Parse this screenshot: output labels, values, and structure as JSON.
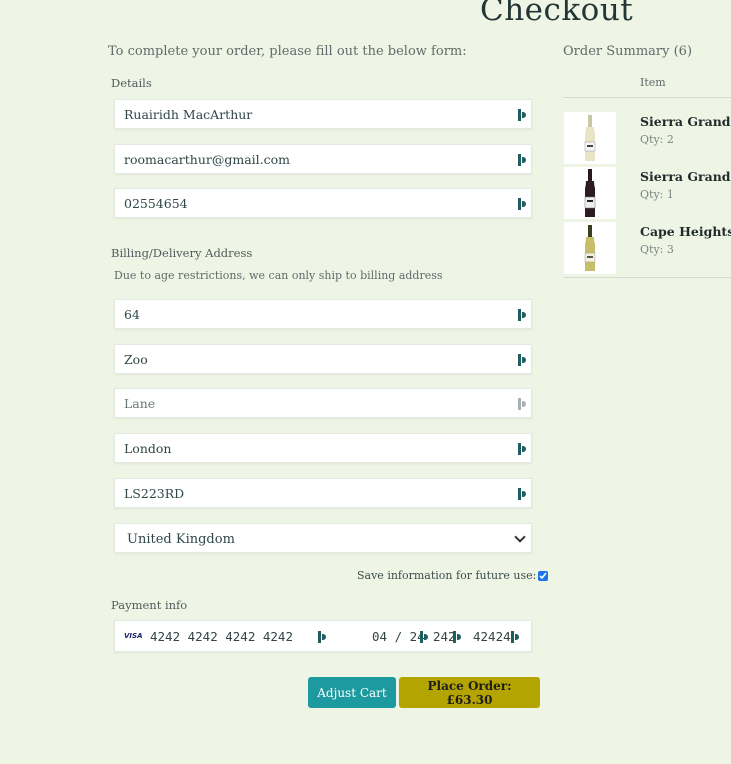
{
  "header": {
    "title": "Checkout"
  },
  "form": {
    "intro": "To complete your order, please fill out the below form:",
    "details_label": "Details",
    "name": "Ruairidh MacArthur",
    "email": "roomacarthur@gmail.com",
    "phone": "02554654",
    "address_label": "Billing/Delivery Address",
    "address_note": "Due to age restrictions, we can only ship to billing address",
    "street1": "64",
    "street2": "Zoo",
    "street3": "",
    "street3_placeholder": "Lane",
    "city": "London",
    "postcode": "LS223RD",
    "country": "United Kingdom",
    "save_label": "Save information for future use:",
    "save_checked": true,
    "payment_label": "Payment info",
    "card": {
      "brand": "VISA",
      "number": "4242 4242 4242 4242",
      "expiry": "04 / 24",
      "cvc": "242",
      "zip": "42424"
    }
  },
  "actions": {
    "adjust_cart": "Adjust Cart",
    "place_order": "Place Order: £63.30"
  },
  "summary": {
    "title": "Order Summary (6)",
    "column_item": "Item",
    "items": [
      {
        "name": "Sierra Grande,",
        "qty": "Qty: 2",
        "bottle": "white"
      },
      {
        "name": "Sierra Grande,",
        "qty": "Qty: 1",
        "bottle": "red"
      },
      {
        "name": "Cape Heights",
        "qty": "Qty: 3",
        "bottle": "white"
      }
    ]
  },
  "colors": {
    "background": "#eff5e5",
    "adjust_button": "#1c9aa0",
    "place_button": "#b4a400"
  }
}
